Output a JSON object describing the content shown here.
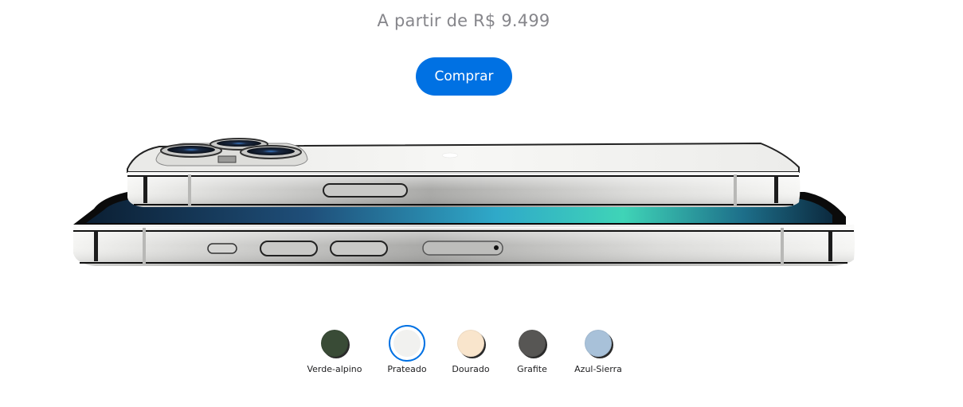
{
  "price_text": "A partir de R$ 9.499",
  "buy_label": "Comprar",
  "product_image": "iphone-13-pro-side-view",
  "colors": [
    {
      "name": "Verde-alpino",
      "hex": "#394b36"
    },
    {
      "name": "Prateado",
      "hex": "#f1f1ef",
      "selected": true
    },
    {
      "name": "Dourado",
      "hex": "#f9e5cc"
    },
    {
      "name": "Grafite",
      "hex": "#575654"
    },
    {
      "name": "Azul-Sierra",
      "hex": "#a8c1d9"
    }
  ],
  "accent": "#0071e3"
}
